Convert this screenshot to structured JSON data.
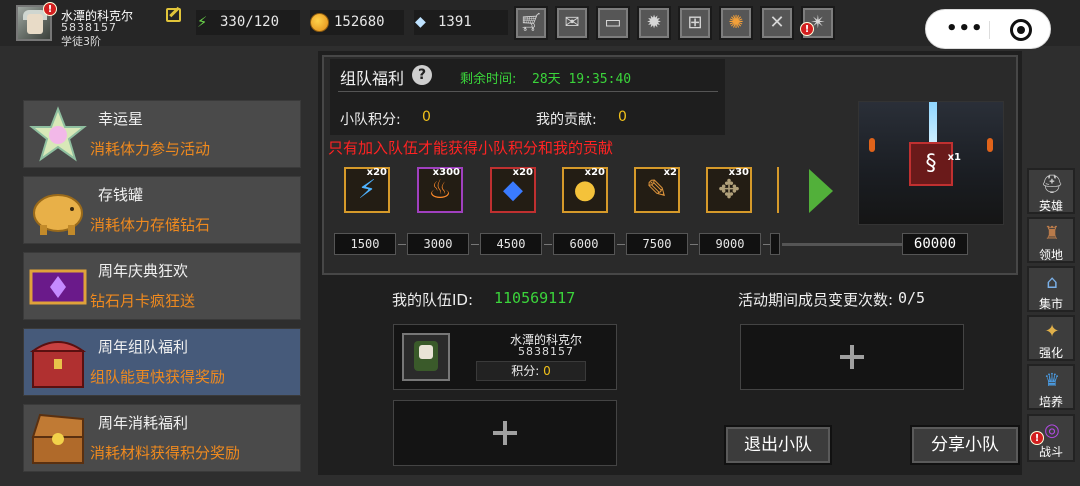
{
  "player": {
    "name": "水潭的科克尔",
    "id": "5838157",
    "rank": "学徒3阶",
    "notification_badge": "!"
  },
  "resources": [
    {
      "icon": "energy-icon",
      "value": "330/120"
    },
    {
      "icon": "coin-icon",
      "value": "152680"
    },
    {
      "icon": "gem-icon",
      "value": "1391"
    }
  ],
  "toolbar_icons": [
    "cart-icon",
    "mail-icon",
    "gamepad-icon",
    "gear-icon",
    "gift-icon",
    "color-wheel-icon",
    "swords-icon",
    "fireworks-icon"
  ],
  "toolbar_badge": "!",
  "miniapp": {
    "more": "•••"
  },
  "menu": [
    {
      "title": "幸运星",
      "subtitle": "消耗体力参与活动",
      "icon": "lucky-star-icon"
    },
    {
      "title": "存钱罐",
      "subtitle": "消耗体力存储钻石",
      "icon": "piggy-bank-icon"
    },
    {
      "title": "周年庆典狂欢",
      "subtitle": "钻石月卡疯狂送",
      "icon": "purple-card-icon"
    },
    {
      "title": "周年组队福利",
      "subtitle": "组队能更快获得奖励",
      "icon": "treasure-chest-icon"
    },
    {
      "title": "周年消耗福利",
      "subtitle": "消耗材料获得积分奖励",
      "icon": "open-chest-icon"
    }
  ],
  "welfare": {
    "title": "组队福利",
    "help": "?",
    "time_label": "剩余时间:",
    "time_value": "28天 19:35:40",
    "team_score_label": "小队积分:",
    "team_score_value": "0",
    "contrib_label": "我的贡献:",
    "contrib_value": "0",
    "warning": "只有加入队伍才能获得小队积分和我的贡献"
  },
  "rewards": [
    {
      "qty": "x20",
      "icon": "lightning-scroll-icon",
      "glyph": "⚡",
      "color": "#4fb3ff"
    },
    {
      "qty": "x300",
      "icon": "fire-potion-icon",
      "glyph": "♨",
      "color": "#ff8a2a"
    },
    {
      "qty": "x20",
      "icon": "blue-gem-icon",
      "glyph": "◆",
      "color": "#3a7bff"
    },
    {
      "qty": "x20",
      "icon": "golden-egg-icon",
      "glyph": "●",
      "color": "#f4c23a"
    },
    {
      "qty": "x2",
      "icon": "telescope-icon",
      "glyph": "✎",
      "color": "#d7903a"
    },
    {
      "qty": "x30",
      "icon": "mace-icon",
      "glyph": "✥",
      "color": "#b0a07a"
    }
  ],
  "milestones": [
    "1500",
    "3000",
    "4500",
    "6000",
    "7500",
    "9000"
  ],
  "milestone_final": "60000",
  "preview_item": {
    "qty": "x1",
    "glyph": "§"
  },
  "team": {
    "id_label": "我的队伍ID:",
    "id_value": "110569117",
    "changes_label": "活动期间成员变更次数:",
    "changes_value": "0/5",
    "member": {
      "name": "水潭的科克尔",
      "id": "5838157",
      "score_label": "积分:",
      "score_value": "0"
    },
    "leave_button": "退出小队",
    "share_button": "分享小队"
  },
  "right_nav": [
    {
      "label": "英雄",
      "icon": "helmet-icon",
      "glyph": "⛑"
    },
    {
      "label": "领地",
      "icon": "castle-icon",
      "glyph": "♜"
    },
    {
      "label": "集市",
      "icon": "market-icon",
      "glyph": "⌂"
    },
    {
      "label": "强化",
      "icon": "enhance-icon",
      "glyph": "✦"
    },
    {
      "label": "培养",
      "icon": "trophy-icon",
      "glyph": "♛"
    },
    {
      "label": "战斗",
      "icon": "portal-icon",
      "glyph": "◎"
    }
  ],
  "right_nav_badge": "!"
}
